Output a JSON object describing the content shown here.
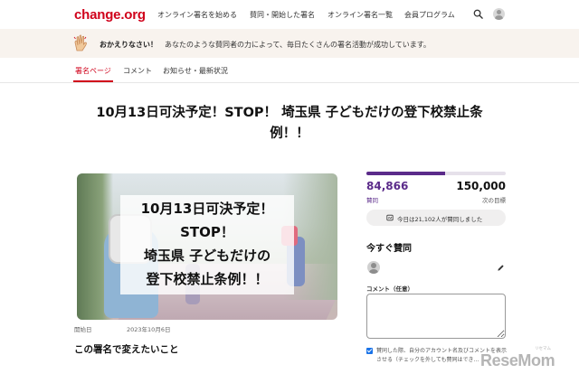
{
  "nav": {
    "logo": "change.org",
    "links": [
      "オンライン署名を始める",
      "賛同・開始した署名",
      "オンライン署名一覧",
      "会員プログラム"
    ],
    "search_icon": "search-icon",
    "avatar_icon": "user-avatar-icon",
    "brand_color": "#d0021b"
  },
  "banner": {
    "bold": "おかえりなさい！",
    "text": "あなたのような賛同者の力によって、毎日たくさんの署名活動が成功しています。",
    "icon": "clapping-hands-icon"
  },
  "tabs": [
    {
      "label": "署名ページ",
      "active": true
    },
    {
      "label": "コメント",
      "active": false
    },
    {
      "label": "お知らせ・最新状況",
      "active": false
    }
  ],
  "petition": {
    "title_line1": "10月13日可決予定！STOP！ 埼玉県 子どもだけの登下校禁止条",
    "title_line2": "例！！",
    "image_text": [
      "10月13日可決予定！",
      "STOP！",
      "埼玉県 子どもだけの",
      "登下校禁止条例！！"
    ],
    "started_label": "開始日",
    "started_date": "2023年10月6日",
    "section_heading": "この署名で変えたいこと"
  },
  "progress": {
    "count": "84,866",
    "count_label": "賛同",
    "goal": "150,000",
    "goal_label": "次の目標",
    "fraction": 0.566,
    "accent_color": "#5b2b8a",
    "today_text": "今日は21,102人が賛同しました",
    "today_icon": "signature-icon"
  },
  "sign_form": {
    "heading": "今すぐ賛同",
    "avatar_icon": "user-avatar-icon",
    "edit_icon": "pencil-icon",
    "comment_label": "コメント（任意）",
    "comment_value": "",
    "consent_text": "賛同した際、自分のアカウント名及びコメントを表示させる（チェックを外しても賛同はでき…",
    "consent_checked": true
  },
  "watermark": {
    "logo": "ReseMom",
    "ruby": "リセマム"
  }
}
